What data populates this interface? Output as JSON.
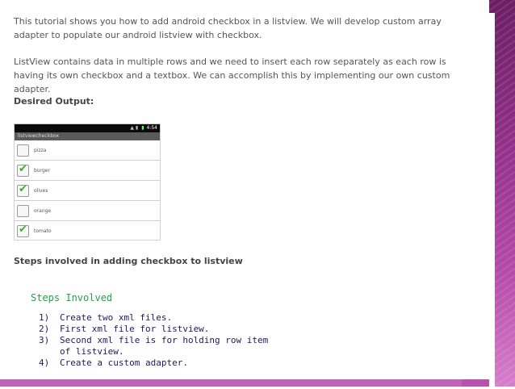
{
  "intro": {
    "p1": "This tutorial shows you how to add android checkbox in a listview. We will develop custom array adapter to populate our android listview with checkbox.",
    "p2": "ListView contains data in multiple rows and we need to insert each row separately as each row is having its own checkbox and a textbox. We can accomplish this by implementing our own custom adapter.",
    "desired_output": "Desired Output:"
  },
  "phone": {
    "status_time": "4:54",
    "app_title": "listviewcheckbox",
    "items": [
      {
        "label": "pizza",
        "checked": false
      },
      {
        "label": "burger",
        "checked": true
      },
      {
        "label": "olives",
        "checked": true
      },
      {
        "label": "orange",
        "checked": false
      },
      {
        "label": "tomato",
        "checked": true
      }
    ]
  },
  "steps": {
    "heading": "Steps involved in adding checkbox to listview",
    "title": "Steps Involved",
    "items": [
      {
        "num": "1)",
        "text": "Create two xml files."
      },
      {
        "num": "2)",
        "text": "First xml file for listview."
      },
      {
        "num": "3)",
        "text": "Second xml file is for holding row item",
        "cont": "of listview."
      },
      {
        "num": "4)",
        "text": "Create a custom adapter."
      }
    ]
  },
  "colors": {
    "accent_purple": "#8f2f86",
    "check_green": "#3fae2a",
    "code_green": "#24a24a",
    "code_navy": "#1a1a66"
  }
}
